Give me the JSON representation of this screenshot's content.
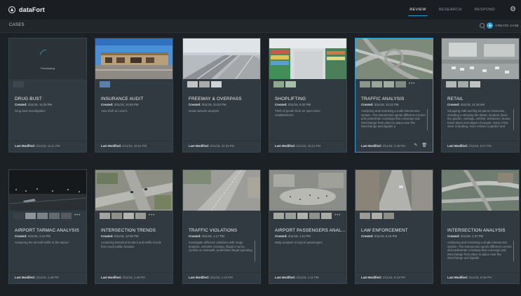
{
  "app": {
    "name": "dataFort"
  },
  "nav": {
    "tabs": [
      "REVIEW",
      "RESEARCH",
      "RESPOND"
    ],
    "active": 0
  },
  "subbar": {
    "title": "CASES",
    "create_label": "CREATE CASE"
  },
  "cards": [
    {
      "title": "DRUG BUST",
      "created_label": "Created:",
      "created": "3/11/18, 11:03 PM",
      "description": "Drug bust investigation",
      "modified_label": "Last Modified:",
      "modified": "3/11/18, 11:11 PM",
      "processing": "Processing",
      "thumb": "processing"
    },
    {
      "title": "INSURANCE AUDIT",
      "created_label": "Created:",
      "created": "3/11/18, 10:45 PM",
      "description": "Auto theft at Lowe's",
      "modified_label": "Last Modified:",
      "modified": "3/11/18, 10:51 PM",
      "thumb": "building"
    },
    {
      "title": "FREEWAY & OVERPASS",
      "created_label": "Created:",
      "created": "3/11/18, 10:33 PM",
      "description": "Road network analysis",
      "modified_label": "Last Modified:",
      "modified": "3/11/18, 10:33 PM",
      "thumb": "freeway"
    },
    {
      "title": "SHOPLIFTING",
      "created_label": "Created:",
      "created": "3/11/18, 9:32 PM",
      "description": "Theft of goods from an open store establishment",
      "modified_label": "Last Modified:",
      "modified": "3/11/18, 10:21 PM",
      "thumb": "store"
    },
    {
      "title": "TRAFFIC ANALYSIS",
      "created_label": "Created:",
      "created": "3/11/18, 10:12 PM",
      "description": "Analyzing and reviewing a multi-intersection system. The intersection sports different corners and pedestrian crossings that converge and interchange from place to place near the interchange and signals a",
      "modified_label": "Last Modified:",
      "modified": "3/11/18, 6:48 PM",
      "thumb": "interchange"
    },
    {
      "title": "RETAIL",
      "created_label": "Created:",
      "created": "3/11/18, 11:18 AM",
      "description": "Shopping mall and big lot parcel showcase, including a showing the street, vendors down the garden, carriage, vehicle, entrances, buses, travel lanes and edges of people, many of the store is landing, more visitors a garden and",
      "modified_label": "Last Modified:",
      "modified": "3/11/18, 6:47 PM",
      "thumb": "parking"
    },
    {
      "title": "AIRPORT TARMAC ANALYSIS",
      "created_label": "Created:",
      "created": "3/11/18, 1:11 PM",
      "description": "Analyzing the aircraft traffic in the airport",
      "modified_label": "Last Modified:",
      "modified": "3/11/18, 1:36 PM",
      "thumb": "tarmac"
    },
    {
      "title": "INTERSECTION TRENDS",
      "created_label": "Created:",
      "created": "3/11/18, 12:08 PM",
      "description": "Analyzing historical incident and traffic trends from each public location",
      "modified_label": "Last Modified:",
      "modified": "3/11/18, 1:48 PM",
      "thumb": "intersection"
    },
    {
      "title": "TRAFFIC VIOLATIONS",
      "created_label": "Created:",
      "created": "3/11/18, 1:17 PM",
      "description": "Investigate different violations with range analysis, vehicles crossing, illegal U-turns, cyclists on sidewalk, pedestrian illegal speeding",
      "modified_label": "Last Modified:",
      "modified": "3/11/18, 1:13 PM",
      "thumb": "road"
    },
    {
      "title": "AIRPORT PASSENGERS ANAL...",
      "created_label": "Created:",
      "created": "3/11/18, 1:11 PM",
      "description": "Daily analysis of airport passengers",
      "modified_label": "Last Modified:",
      "modified": "3/11/18, 1:11 PM",
      "thumb": "plaza"
    },
    {
      "title": "LAW ENFORCEMENT",
      "created_label": "Created:",
      "created": "3/11/18, 8:19 PM",
      "description": "",
      "modified_label": "Last Modified:",
      "modified": "3/11/18, 8:19 PM",
      "thumb": "street"
    },
    {
      "title": "INTERSECTION ANALYSIS",
      "created_label": "Created:",
      "created": "3/11/18, 1:37 PM",
      "description": "Analyzing and reviewing a single intersection system. The intersection sports different corners and pedestrian crossings that converge and interchange from place to place near the interchange and signals",
      "modified_label": "Last Modified:",
      "modified": "3/11/18, 6:05 PM",
      "thumb": "interchange2"
    }
  ]
}
